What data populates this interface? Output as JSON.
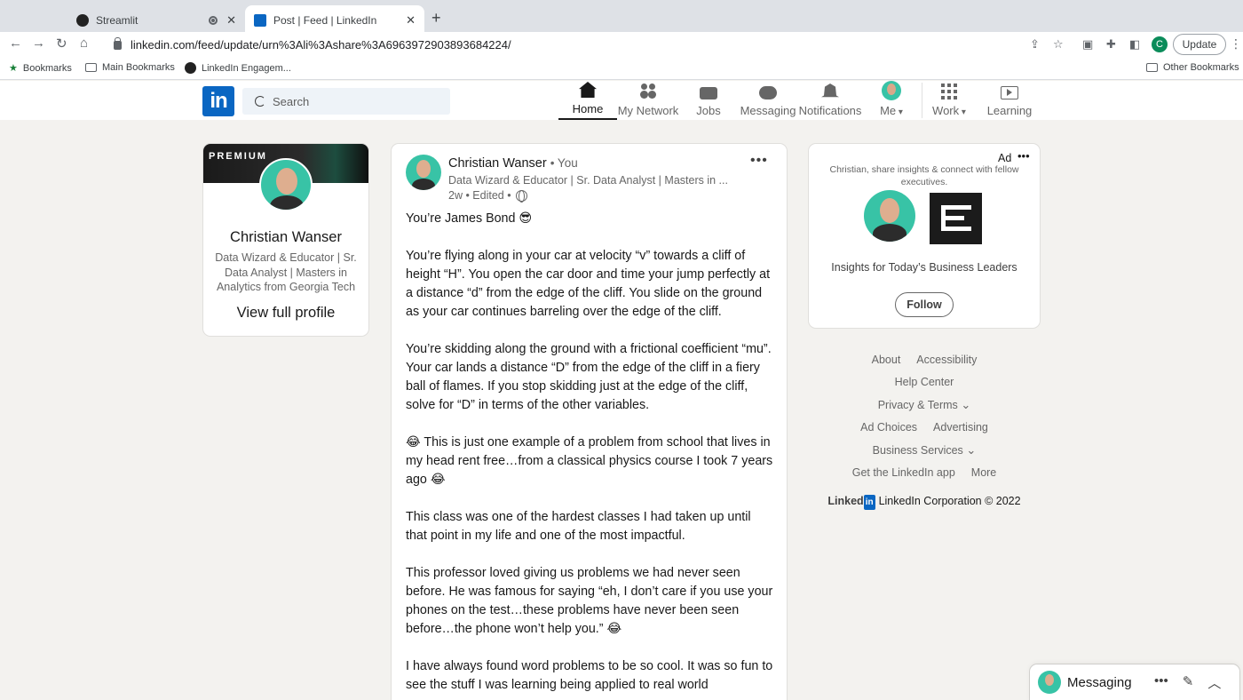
{
  "browser": {
    "tabs": [
      {
        "title": "Streamlit"
      },
      {
        "title": "Post | Feed | LinkedIn"
      }
    ],
    "url": "linkedin.com/feed/update/urn%3Ali%3Ashare%3A6963972903893684224/",
    "update_label": "Update",
    "profile_initial": "C",
    "bookmarks": [
      "Bookmarks",
      "Main Bookmarks",
      "LinkedIn Engagem..."
    ],
    "other_bookmarks": "Other Bookmarks"
  },
  "linkedin_nav": {
    "logo": "in",
    "search_placeholder": "Search",
    "items": [
      {
        "label": "Home",
        "icon": "home-icon"
      },
      {
        "label": "My Network",
        "icon": "network-icon"
      },
      {
        "label": "Jobs",
        "icon": "briefcase-icon"
      },
      {
        "label": "Messaging",
        "icon": "messaging-icon"
      },
      {
        "label": "Notifications",
        "icon": "bell-icon"
      },
      {
        "label": "Me",
        "icon": "avatar"
      },
      {
        "label": "Work",
        "icon": "grid-icon"
      },
      {
        "label": "Learning",
        "icon": "learning-icon"
      }
    ]
  },
  "profile_card": {
    "banner_text": "PREMIUM",
    "name": "Christian Wanser",
    "headline": "Data Wizard & Educator | Sr. Data Analyst | Masters in Analytics from Georgia Tech",
    "view_profile": "View full profile"
  },
  "post": {
    "author": "Christian Wanser",
    "degree": "• You",
    "headline": "Data Wizard & Educator | Sr. Data Analyst | Masters in ...",
    "meta": "2w • Edited •",
    "more": "•••",
    "paragraphs": [
      "You’re James Bond 😎",
      "You’re flying along in your car at velocity “v” towards a cliff of height “H”. You open the car door and time your jump perfectly at a distance “d” from the edge of the cliff. You slide on the ground as your car continues barreling over the edge of the cliff.",
      "You’re skidding along the ground with a frictional coefficient “mu”. Your car lands a distance “D” from the edge of the cliff in a fiery ball of flames. If you stop skidding just at the edge of the cliff, solve for “D” in terms of the other variables.",
      "😂 This is just one example of a problem from school that lives in my head rent free…from a classical physics course I took 7 years ago 😂",
      "This class was one of the hardest classes I had taken up until that point in my life and one of the most impactful.",
      "This professor loved giving us problems we had never seen before. He was famous for saying “eh, I don’t care if you use your phones on the test…these problems have never been seen before…the phone won’t help you.” 😂",
      "I have always found word problems to be so cool. It was so fun to see the stuff I was learning being applied to real world"
    ]
  },
  "ad": {
    "label": "Ad",
    "more": "•••",
    "text": "Christian, share insights & connect with fellow executives.",
    "title": "Insights for Today’s Business Leaders",
    "follow": "Follow"
  },
  "footer": {
    "rows": [
      [
        {
          "label": "About"
        },
        {
          "label": "Accessibility"
        }
      ],
      [
        {
          "label": "Help Center"
        }
      ],
      [
        {
          "label": "Privacy & Terms",
          "chevron": true
        }
      ],
      [
        {
          "label": "Ad Choices"
        },
        {
          "label": "Advertising"
        }
      ],
      [
        {
          "label": "Business Services",
          "chevron": true
        }
      ],
      [
        {
          "label": "Get the LinkedIn app"
        },
        {
          "label": "More"
        }
      ]
    ],
    "wordmark": "Linked",
    "wordmark_in": "in",
    "corp": "LinkedIn Corporation © 2022"
  },
  "messaging": {
    "label": "Messaging"
  }
}
